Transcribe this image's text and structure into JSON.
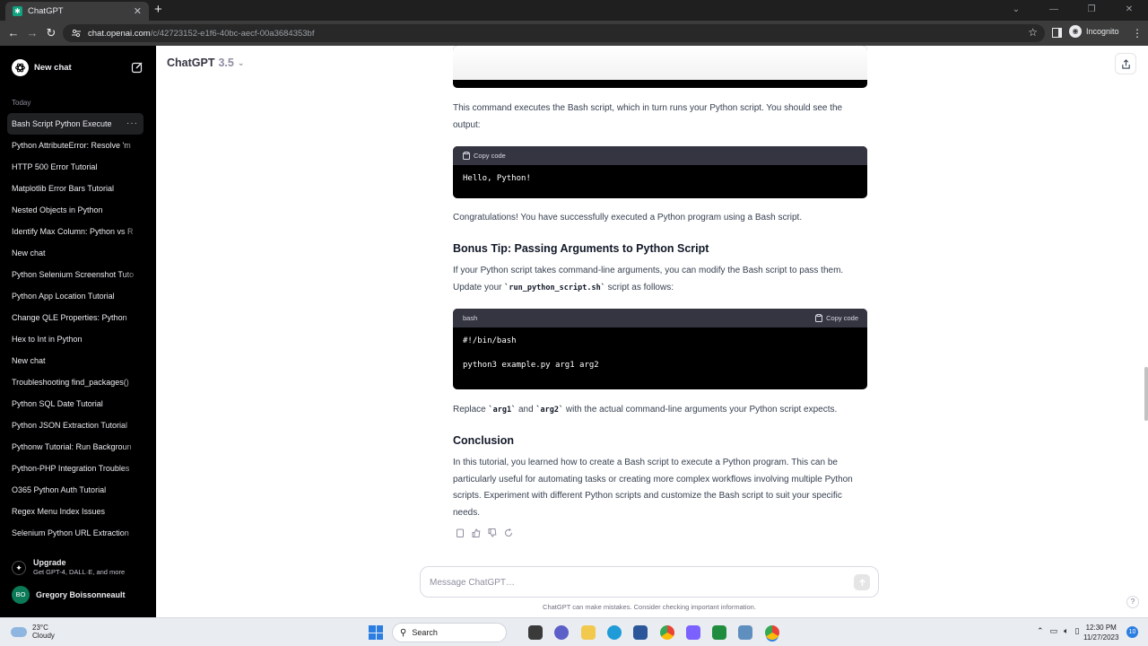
{
  "browser": {
    "tab_title": "ChatGPT",
    "url_host": "chat.openai.com",
    "url_path": "/c/42723152-e1f6-40bc-aecf-00a3684353bf",
    "profile_label": "Incognito"
  },
  "sidebar": {
    "new_chat_label": "New chat",
    "section_today": "Today",
    "history": [
      "Bash Script Python Execute",
      "Python AttributeError: Resolve 'm",
      "HTTP 500 Error Tutorial",
      "Matplotlib Error Bars Tutorial",
      "Nested Objects in Python",
      "Identify Max Column: Python vs R",
      "New chat",
      "Python Selenium Screenshot Tuto",
      "Python App Location Tutorial",
      "Change QLE Properties: Python",
      "Hex to Int in Python",
      "New chat",
      "Troubleshooting find_packages()",
      "Python SQL Date Tutorial",
      "Python JSON Extraction Tutorial",
      "Pythonw Tutorial: Run Backgroun",
      "Python-PHP Integration Troubles",
      "O365 Python Auth Tutorial",
      "Regex Menu Index Issues",
      "Selenium Python URL Extraction"
    ],
    "upgrade_title": "Upgrade",
    "upgrade_subtitle": "Get GPT-4, DALL·E, and more",
    "user_initials": "BO",
    "user_name": "Gregory Boissonneault"
  },
  "header": {
    "model_name": "ChatGPT",
    "model_version": "3.5"
  },
  "message": {
    "p1": "This command executes the Bash script, which in turn runs your Python script. You should see the output:",
    "code1": {
      "copy_label": "Copy code",
      "line1": "Hello, Python!"
    },
    "p2": "Congratulations! You have successfully executed a Python program using a Bash script.",
    "h_bonus": "Bonus Tip: Passing Arguments to Python Script",
    "p3_a": "If your Python script takes command-line arguments, you can modify the Bash script to pass them. Update your ",
    "p3_code": "`run_python_script.sh`",
    "p3_b": " script as follows:",
    "code2": {
      "lang": "bash",
      "copy_label": "Copy code",
      "line1": "#!/bin/bash",
      "line2": "python3 example.py arg1 arg2"
    },
    "p4_a": "Replace ",
    "p4_code1": "`arg1`",
    "p4_mid": " and ",
    "p4_code2": "`arg2`",
    "p4_b": " with the actual command-line arguments your Python script expects.",
    "h_conclusion": "Conclusion",
    "p5": "In this tutorial, you learned how to create a Bash script to execute a Python program. This can be particularly useful for automating tasks or creating more complex workflows involving multiple Python scripts. Experiment with different Python scripts and customize the Bash script to suit your specific needs."
  },
  "composer": {
    "placeholder": "Message ChatGPT…",
    "disclaimer": "ChatGPT can make mistakes. Consider checking important information.",
    "help": "?"
  },
  "taskbar": {
    "temperature": "23°C",
    "condition": "Cloudy",
    "search_label": "Search",
    "time": "12:30 PM",
    "date": "11/27/2023",
    "notification_count": "10"
  },
  "colors": {
    "sidebar_bg": "#000000",
    "code_bg": "#000000",
    "code_header_bg": "#343541",
    "brand": "#10a37f"
  }
}
